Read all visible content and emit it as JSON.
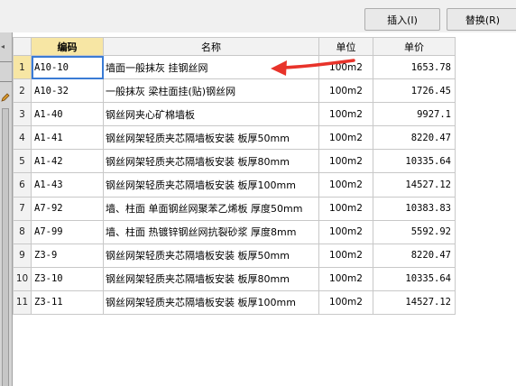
{
  "toolbar": {
    "insert_label": "插入(I)",
    "replace_label": "替换(R)"
  },
  "table": {
    "headers": {
      "row_num": "",
      "code": "编码",
      "name": "名称",
      "unit": "单位",
      "price": "单价"
    },
    "rows": [
      {
        "num": "1",
        "code": "A10-10",
        "name": "墙面一般抹灰 挂钢丝网",
        "unit": "100m2",
        "price": "1653.78"
      },
      {
        "num": "2",
        "code": "A10-32",
        "name": "一般抹灰 梁柱面挂(贴)钢丝网",
        "unit": "100m2",
        "price": "1726.45"
      },
      {
        "num": "3",
        "code": "A1-40",
        "name": "钢丝网夹心矿棉墙板",
        "unit": "100m2",
        "price": "9927.1"
      },
      {
        "num": "4",
        "code": "A1-41",
        "name": "钢丝网架轻质夹芯隔墙板安装 板厚50mm",
        "unit": "100m2",
        "price": "8220.47"
      },
      {
        "num": "5",
        "code": "A1-42",
        "name": "钢丝网架轻质夹芯隔墙板安装 板厚80mm",
        "unit": "100m2",
        "price": "10335.64"
      },
      {
        "num": "6",
        "code": "A1-43",
        "name": "钢丝网架轻质夹芯隔墙板安装 板厚100mm",
        "unit": "100m2",
        "price": "14527.12"
      },
      {
        "num": "7",
        "code": "A7-92",
        "name": "墙、柱面 单面钢丝网聚苯乙烯板 厚度50mm",
        "unit": "100m2",
        "price": "10383.83"
      },
      {
        "num": "8",
        "code": "A7-99",
        "name": "墙、柱面 热镀锌钢丝网抗裂砂浆 厚度8mm",
        "unit": "100m2",
        "price": "5592.92"
      },
      {
        "num": "9",
        "code": "Z3-9",
        "name": "钢丝网架轻质夹芯隔墙板安装 板厚50mm",
        "unit": "100m2",
        "price": "8220.47"
      },
      {
        "num": "10",
        "code": "Z3-10",
        "name": "钢丝网架轻质夹芯隔墙板安装 板厚80mm",
        "unit": "100m2",
        "price": "10335.64"
      },
      {
        "num": "11",
        "code": "Z3-11",
        "name": "钢丝网架轻质夹芯隔墙板安装 板厚100mm",
        "unit": "100m2",
        "price": "14527.12"
      }
    ]
  },
  "colors": {
    "header_highlight": "#f7e6a4",
    "annotation_arrow": "#e8332a",
    "selection_border": "#3a7bd5"
  }
}
